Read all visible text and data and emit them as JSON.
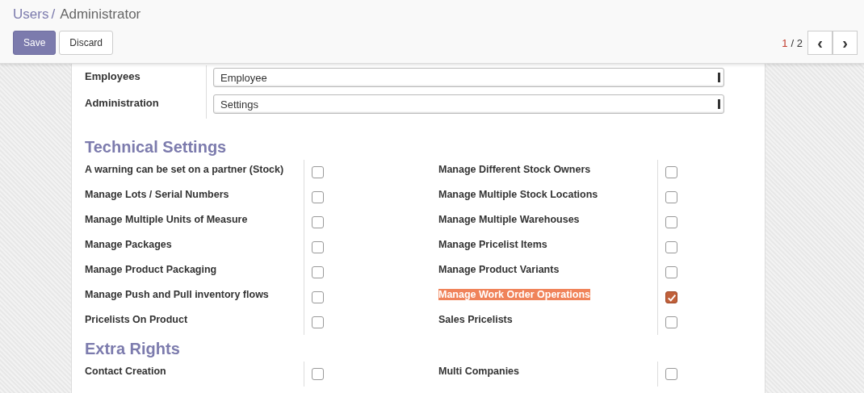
{
  "breadcrumb": {
    "parent": "Users",
    "separator": "/",
    "current": "Administrator"
  },
  "buttons": [
    {
      "label": "Save",
      "kind": "primary"
    },
    {
      "label": "Discard",
      "kind": "secondary"
    }
  ],
  "pager": {
    "current": "1",
    "separator": "/",
    "total": "2",
    "prev": "‹",
    "next": "›"
  },
  "fields": [
    {
      "label": "Employees",
      "value": "Employee"
    },
    {
      "label": "Administration",
      "value": "Settings"
    }
  ],
  "sections": [
    {
      "title": "Technical Settings",
      "rows": [
        {
          "left": {
            "label": "A warning can be set on a partner (Stock)",
            "checked": false,
            "highlighted": false
          },
          "right": {
            "label": "Manage Different Stock Owners",
            "checked": false,
            "highlighted": false
          }
        },
        {
          "left": {
            "label": "Manage Lots / Serial Numbers",
            "checked": false,
            "highlighted": false
          },
          "right": {
            "label": "Manage Multiple Stock Locations",
            "checked": false,
            "highlighted": false
          }
        },
        {
          "left": {
            "label": "Manage Multiple Units of Measure",
            "checked": false,
            "highlighted": false
          },
          "right": {
            "label": "Manage Multiple Warehouses",
            "checked": false,
            "highlighted": false
          }
        },
        {
          "left": {
            "label": "Manage Packages",
            "checked": false,
            "highlighted": false
          },
          "right": {
            "label": "Manage Pricelist Items",
            "checked": false,
            "highlighted": false
          }
        },
        {
          "left": {
            "label": "Manage Product Packaging",
            "checked": false,
            "highlighted": false
          },
          "right": {
            "label": "Manage Product Variants",
            "checked": false,
            "highlighted": false
          }
        },
        {
          "left": {
            "label": "Manage Push and Pull inventory flows",
            "checked": false,
            "highlighted": false
          },
          "right": {
            "label": "Manage Work Order Operations",
            "checked": true,
            "highlighted": true
          }
        },
        {
          "left": {
            "label": "Pricelists On Product",
            "checked": false,
            "highlighted": false
          },
          "right": {
            "label": "Sales Pricelists",
            "checked": false,
            "highlighted": false
          }
        }
      ]
    },
    {
      "title": "Extra Rights",
      "rows": [
        {
          "left": {
            "label": "Contact Creation",
            "checked": false,
            "highlighted": false
          },
          "right": {
            "label": "Multi Companies",
            "checked": false,
            "highlighted": false
          }
        }
      ]
    }
  ]
}
